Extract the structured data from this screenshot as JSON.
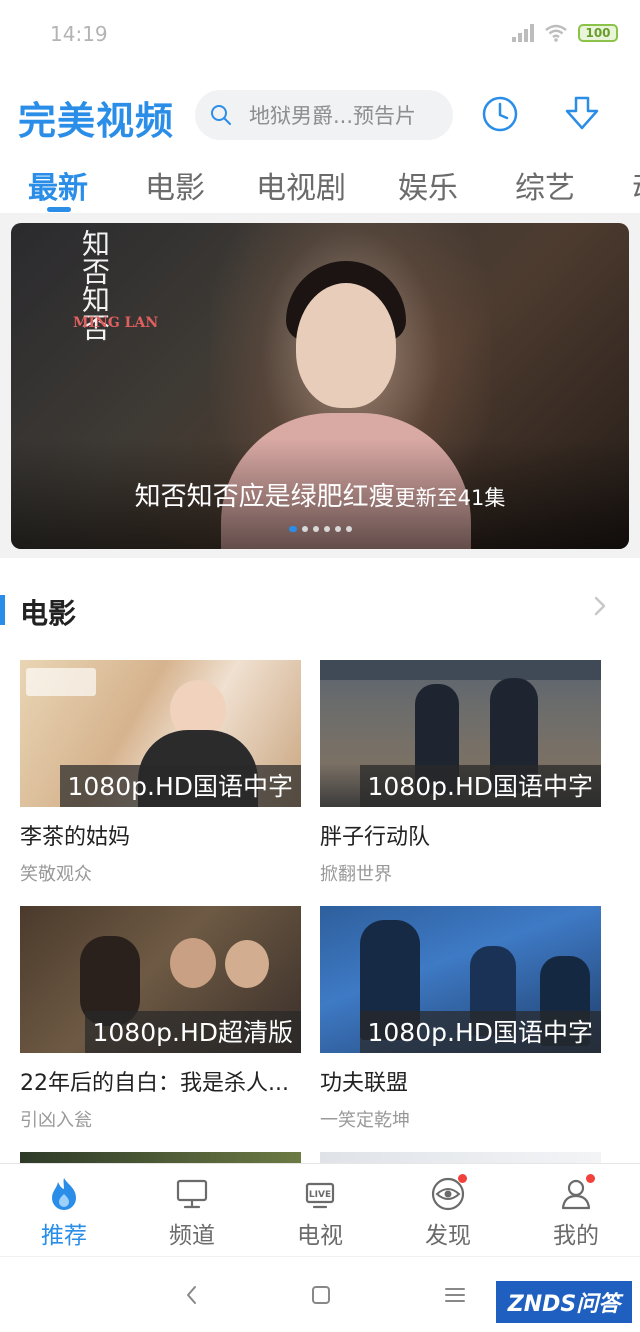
{
  "status_bar": {
    "time": "14:19",
    "battery": "100"
  },
  "header": {
    "logo": "完美视频",
    "search_placeholder": "地狱男爵...预告片"
  },
  "tabs": [
    "最新",
    "电影",
    "电视剧",
    "娱乐",
    "综艺",
    "动"
  ],
  "banner": {
    "poster_title": "知否知否",
    "poster_sub": "MING LAN",
    "caption_main": "知否知否应是绿肥红瘦",
    "caption_extra": "更新至41集",
    "dots_count": 6,
    "active_dot": 0
  },
  "section": {
    "title": "电影"
  },
  "movies": [
    {
      "title": "李茶的姑妈",
      "subtitle": "笑敬观众",
      "badge": "1080p.HD国语中字"
    },
    {
      "title": "胖子行动队",
      "subtitle": "掀翻世界",
      "badge": "1080p.HD国语中字"
    },
    {
      "title": "22年后的自白：我是杀人...",
      "subtitle": "引凶入瓮",
      "badge": "1080p.HD超清版"
    },
    {
      "title": "功夫联盟",
      "subtitle": "一笑定乾坤",
      "badge": "1080p.HD国语中字"
    }
  ],
  "bottom_nav": [
    {
      "label": "推荐",
      "icon": "flame-icon",
      "active": true
    },
    {
      "label": "频道",
      "icon": "monitor-icon",
      "active": false
    },
    {
      "label": "电视",
      "icon": "live-tv-icon",
      "active": false
    },
    {
      "label": "发现",
      "icon": "eye-icon",
      "active": false
    },
    {
      "label": "我的",
      "icon": "user-icon",
      "active": false
    }
  ],
  "watermark": "ZNDS问答",
  "colors": {
    "accent": "#2a8ee8",
    "notification": "#f2403a"
  }
}
